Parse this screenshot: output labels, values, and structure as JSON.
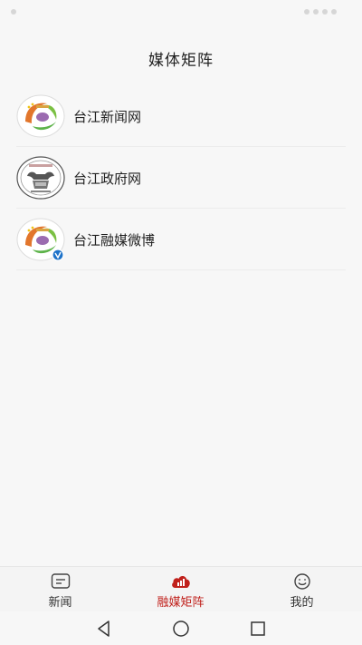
{
  "header": {
    "title": "媒体矩阵"
  },
  "items": [
    {
      "label": "台江新闻网",
      "icon": "news-logo-icon"
    },
    {
      "label": "台江政府网",
      "icon": "gov-seal-icon"
    },
    {
      "label": "台江融媒微博",
      "icon": "weibo-logo-icon",
      "verified": true
    }
  ],
  "tabbar": {
    "tabs": [
      {
        "label": "新闻",
        "icon": "message-icon",
        "active": false
      },
      {
        "label": "融媒矩阵",
        "icon": "cloud-chart-icon",
        "active": true
      },
      {
        "label": "我的",
        "icon": "smile-icon",
        "active": false
      }
    ]
  },
  "colors": {
    "accent": "#c0201b",
    "verified": "#1e73c9",
    "background": "#f7f7f7"
  }
}
